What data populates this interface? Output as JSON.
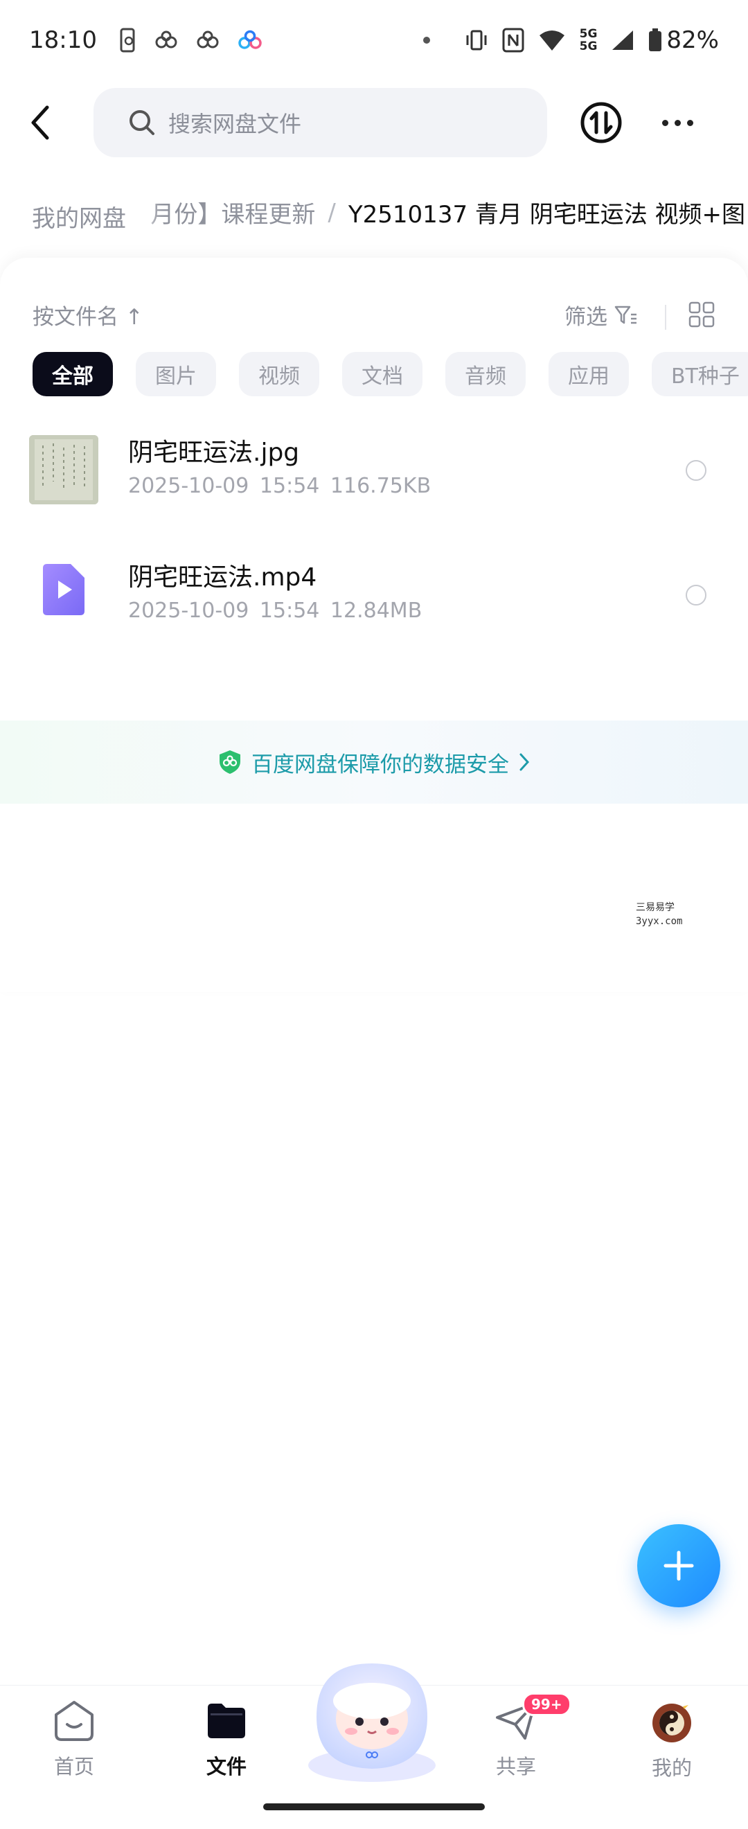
{
  "status_bar": {
    "time": "18:10",
    "network_top": "5G",
    "network_bottom": "5G",
    "battery": "82%"
  },
  "header": {
    "search_placeholder": "搜索网盘文件"
  },
  "breadcrumb": {
    "root": "我的网盘",
    "middle": "月份】课程更新",
    "separator": "/",
    "current": "Y2510137 青月 阴宅旺运法 视频+图"
  },
  "toolbar": {
    "sort_label": "按文件名 ↑",
    "filter_label": "筛选"
  },
  "chips": [
    {
      "label": "全部",
      "active": true
    },
    {
      "label": "图片",
      "active": false
    },
    {
      "label": "视频",
      "active": false
    },
    {
      "label": "文档",
      "active": false
    },
    {
      "label": "音频",
      "active": false
    },
    {
      "label": "应用",
      "active": false
    },
    {
      "label": "BT种子",
      "active": false
    }
  ],
  "files": [
    {
      "name": "阴宅旺运法.jpg",
      "date": "2025-10-09",
      "time": "15:54",
      "size": "116.75KB",
      "icon": "image-thumbnail"
    },
    {
      "name": "阴宅旺运法.mp4",
      "date": "2025-10-09",
      "time": "15:54",
      "size": "12.84MB",
      "icon": "video-file-icon"
    }
  ],
  "security_banner": {
    "text": "百度网盘保障你的数据安全"
  },
  "watermark": {
    "line1": "三易易学",
    "line2": "3yyx.com"
  },
  "bottom_nav": {
    "items": [
      {
        "label": "首页",
        "active": false
      },
      {
        "label": "文件",
        "active": true
      },
      {
        "label": "共享",
        "active": false,
        "badge": "99+"
      },
      {
        "label": "我的",
        "active": false
      }
    ]
  },
  "colors": {
    "accent": "#1e8bff",
    "active_chip": "#0b0c1a",
    "security_text": "#1c9ba9",
    "badge": "#ff3d6b"
  }
}
